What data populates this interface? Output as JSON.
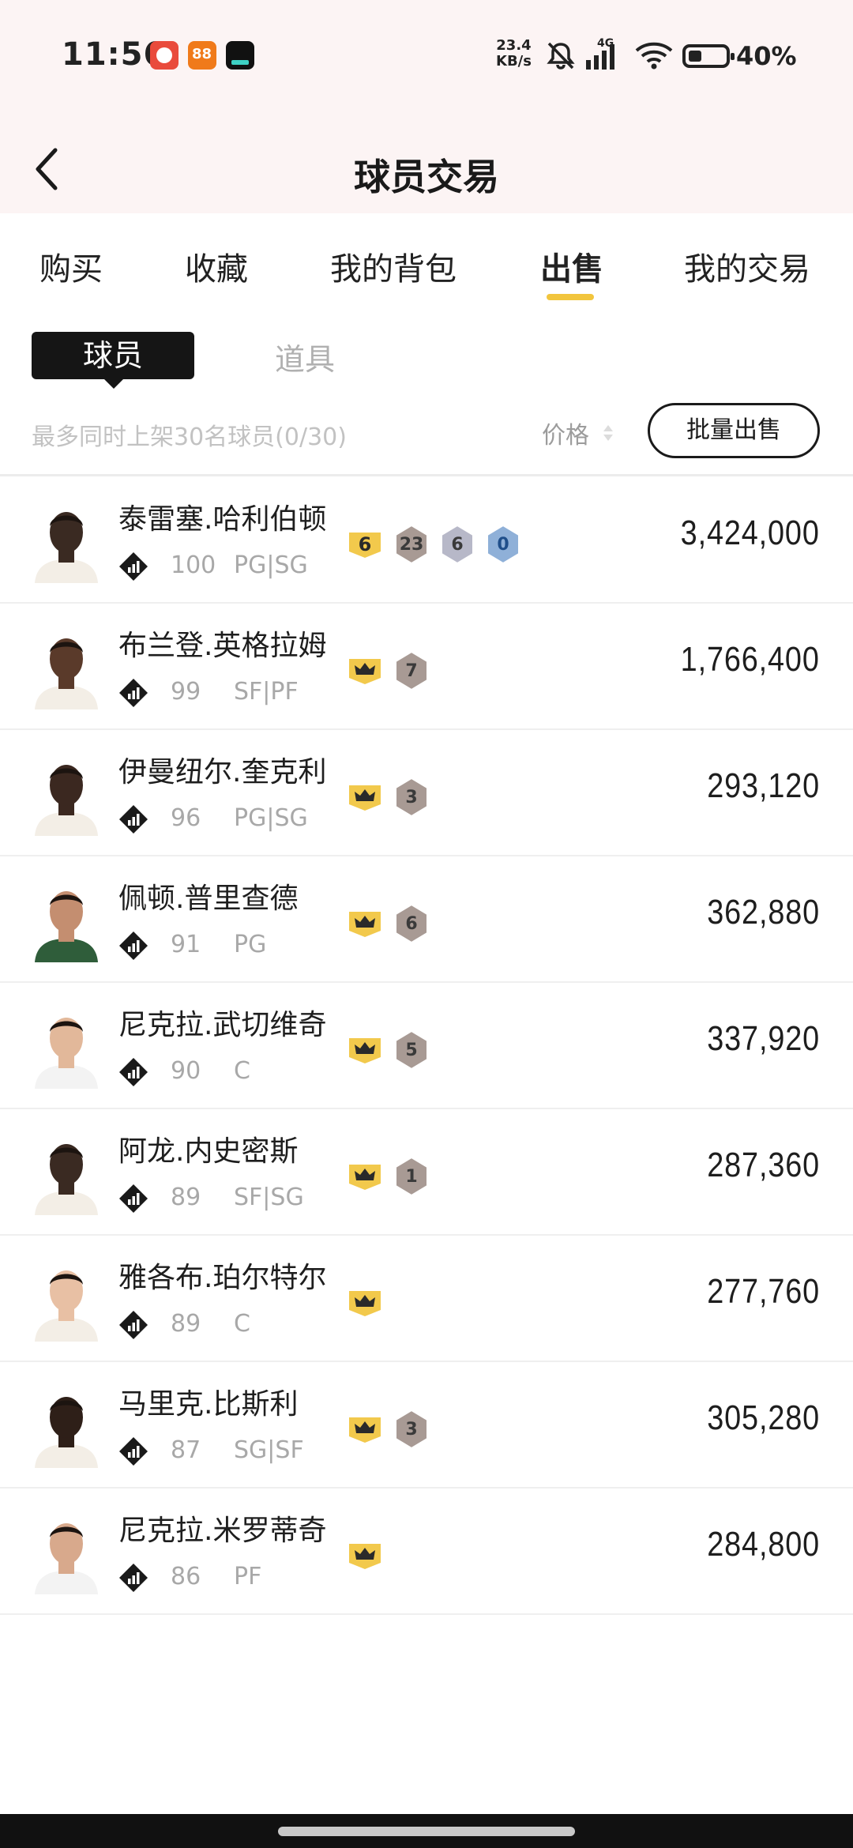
{
  "status_bar": {
    "time": "11:56",
    "net_speed_value": "23.4",
    "net_speed_unit": "KB/s",
    "network": "4G",
    "battery": "40%",
    "icons": [
      "app-icon",
      "app-icon",
      "app-icon",
      "bell-off-icon",
      "signal-icon",
      "wifi-icon",
      "battery-icon"
    ]
  },
  "header": {
    "title": "球员交易"
  },
  "tabs": [
    {
      "label": "购买"
    },
    {
      "label": "收藏"
    },
    {
      "label": "我的背包"
    },
    {
      "label": "出售",
      "active": true
    },
    {
      "label": "我的交易"
    }
  ],
  "subtabs": {
    "active": "球员",
    "inactive": "道具"
  },
  "toolbar": {
    "limit_text": "最多同时上架30名球员(0/30)",
    "price_sort_label": "价格",
    "batch_sell_label": "批量出售"
  },
  "players": [
    {
      "name": "泰雷塞.哈利伯顿",
      "rating": "100",
      "position": "PG|SG",
      "gold_badge": "6",
      "badges": [
        "23",
        "6",
        "0"
      ],
      "price": "3,424,000"
    },
    {
      "name": "布兰登.英格拉姆",
      "rating": "99",
      "position": "SF|PF",
      "gold_badge": "crown",
      "badges": [
        "7"
      ],
      "price": "1,766,400"
    },
    {
      "name": "伊曼纽尔.奎克利",
      "rating": "96",
      "position": "PG|SG",
      "gold_badge": "crown",
      "badges": [
        "3"
      ],
      "price": "293,120"
    },
    {
      "name": "佩顿.普里查德",
      "rating": "91",
      "position": "PG",
      "gold_badge": "crown",
      "badges": [
        "6"
      ],
      "price": "362,880"
    },
    {
      "name": "尼克拉.武切维奇",
      "rating": "90",
      "position": "C",
      "gold_badge": "crown",
      "badges": [
        "5"
      ],
      "price": "337,920"
    },
    {
      "name": "阿龙.内史密斯",
      "rating": "89",
      "position": "SF|SG",
      "gold_badge": "crown",
      "badges": [
        "1"
      ],
      "price": "287,360"
    },
    {
      "name": "雅各布.珀尔特尔",
      "rating": "89",
      "position": "C",
      "gold_badge": "crown",
      "badges": [],
      "price": "277,760"
    },
    {
      "name": "马里克.比斯利",
      "rating": "87",
      "position": "SG|SF",
      "gold_badge": "crown",
      "badges": [
        "3"
      ],
      "price": "305,280"
    },
    {
      "name": "尼克拉.米罗蒂奇",
      "rating": "86",
      "position": "PF",
      "gold_badge": "crown",
      "badges": [],
      "price": "284,800"
    }
  ],
  "colors": {
    "accent": "#f2c53d",
    "header_bg": "#fcf4f4",
    "gold_badge": "#f2c94c",
    "hex_bronze": "#a89a94",
    "hex_silver": "#b7b8c8",
    "hex_blue": "#8fb0d8"
  }
}
